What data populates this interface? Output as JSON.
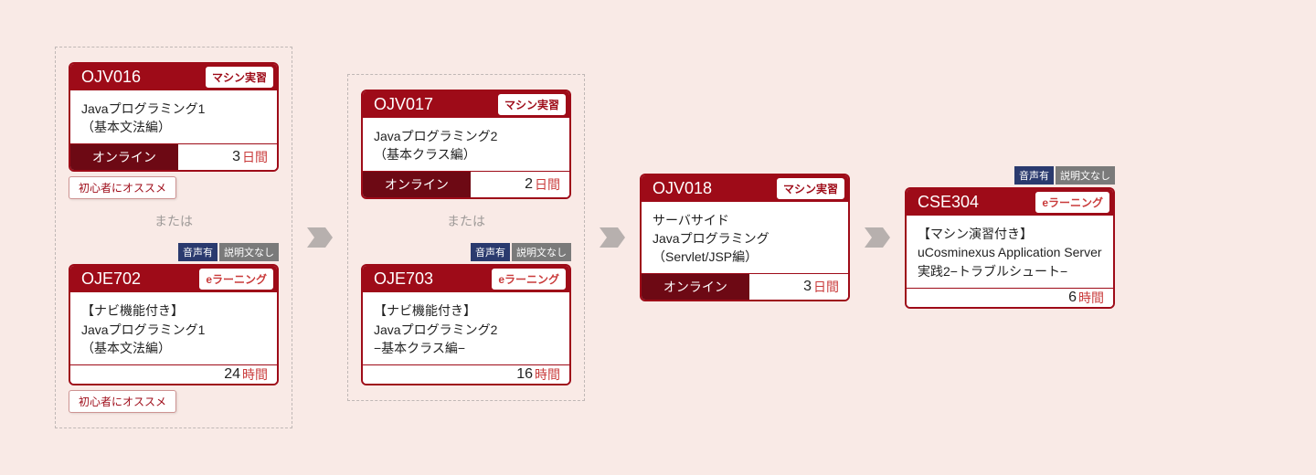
{
  "or_label": "または",
  "audio_tag": {
    "audio": "音声有",
    "nodesc": "説明文なし"
  },
  "badges": {
    "machine": "マシン実習",
    "elearn": "eラーニング"
  },
  "recommend": "初心者にオススメ",
  "mode_online": "オンライン",
  "cards": {
    "ojv016": {
      "code": "OJV016",
      "title": "Javaプログラミング1\n（基本文法編）",
      "dur_num": "3",
      "dur_unit": "日間"
    },
    "oje702": {
      "code": "OJE702",
      "title": "【ナビ機能付き】\nJavaプログラミング1\n（基本文法編）",
      "dur_num": "24",
      "dur_unit": "時間"
    },
    "ojv017": {
      "code": "OJV017",
      "title": "Javaプログラミング2\n（基本クラス編）",
      "dur_num": "2",
      "dur_unit": "日間"
    },
    "oje703": {
      "code": "OJE703",
      "title": "【ナビ機能付き】\nJavaプログラミング2\n−基本クラス編−",
      "dur_num": "16",
      "dur_unit": "時間"
    },
    "ojv018": {
      "code": "OJV018",
      "title": "サーバサイド\nJavaプログラミング\n（Servlet/JSP編）",
      "dur_num": "3",
      "dur_unit": "日間"
    },
    "cse304": {
      "code": "CSE304",
      "title": "【マシン演習付き】\nuCosminexus Application Server実践2−トラブルシュート−",
      "dur_num": "6",
      "dur_unit": "時間"
    }
  }
}
